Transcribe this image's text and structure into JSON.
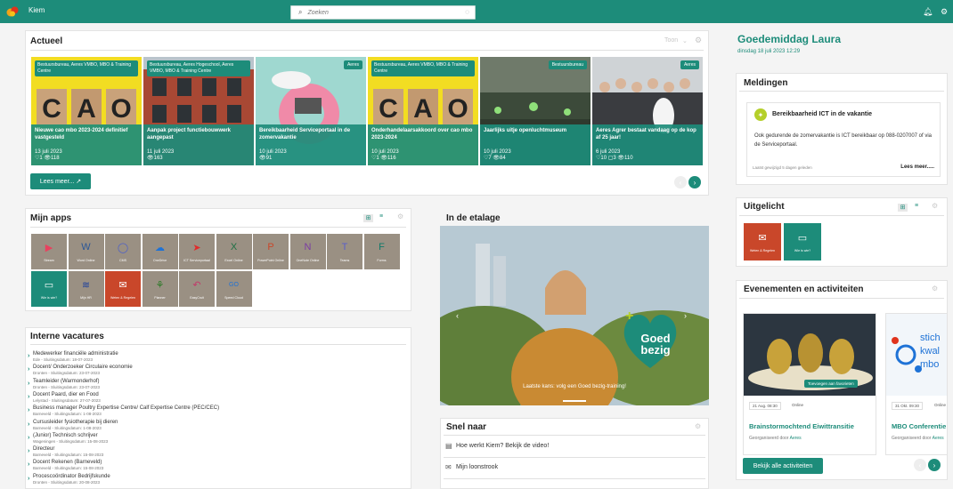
{
  "app": {
    "title": "Kiem"
  },
  "search": {
    "placeholder": "Zoeken"
  },
  "actueel": {
    "title": "Actueel",
    "toggle": "Toon",
    "tiles": [
      {
        "tag": "Bestuursbureau, Aeres VMBO, MBO & Training Centre",
        "title": "Nieuwe cao mbo 2023-2024 definitief vastgesteld",
        "date": "13 juli 2023",
        "meta": "♡1 👁118"
      },
      {
        "tag": "Bestuursbureau, Aeres Hogeschool, Aeres VMBO, MBO & Training Centre",
        "title": "Aanpak project functiebouwwerk aangepast",
        "date": "11 juli 2023",
        "meta": "👁163"
      },
      {
        "tag": "Aeres",
        "title": "Bereikbaarheid Serviceportaal in de zomervakantie",
        "date": "10 juli 2023",
        "meta": "👁91"
      },
      {
        "tag": "Bestuursbureau, Aeres VMBO, MBO & Training Centre",
        "title": "Onderhandelaarsakkoord over cao mbo 2023-2024",
        "date": "10 juli 2023",
        "meta": "♡1 👁116"
      },
      {
        "tag": "Bestuursbureau",
        "title": "Jaarlijks uitje openluchtmuseum",
        "date": "10 juli 2023",
        "meta": "♡7 👁84"
      },
      {
        "tag": "Aeres",
        "title": "Aeres Agrer bestaat vandaag op de kop af 25 jaar!",
        "date": "6 juli 2023",
        "meta": "♡10 ▢3 👁110"
      }
    ],
    "more_label": "Lees meer... ↗"
  },
  "greeting": {
    "title": "Goedemiddag Laura",
    "date": "dinsdag 18 juli 2023 12:29"
  },
  "meldingen": {
    "title": "Meldingen",
    "item_title": "Bereikbaarheid ICT in de vakantie",
    "item_body": "Ook gedurende de zomervakantie is ICT bereikbaar op 088-0207007 of via de Serviceportaal.",
    "item_time": "Laatst gewijzigd 5 dagen geleden",
    "item_more": "Lees meer....."
  },
  "apps": {
    "title": "Mijn apps",
    "items": [
      {
        "label": "Stream",
        "icon": "▶",
        "bg": "#9a9083",
        "ic": "#e8425f"
      },
      {
        "label": "Word Online",
        "icon": "W",
        "bg": "#9a9083",
        "ic": "#2b5797"
      },
      {
        "label": "CMS",
        "icon": "◯",
        "bg": "#9a9083",
        "ic": "#4b5fc9"
      },
      {
        "label": "OneDrive",
        "icon": "☁",
        "bg": "#9a9083",
        "ic": "#1e72d6"
      },
      {
        "label": "ICT Serviceportaal",
        "icon": "➤",
        "bg": "#9a9083",
        "ic": "#e02b2b"
      },
      {
        "label": "Excel Online",
        "icon": "X",
        "bg": "#9a9083",
        "ic": "#1d7044"
      },
      {
        "label": "PowerPoint Online",
        "icon": "P",
        "bg": "#9a9083",
        "ic": "#c9472a"
      },
      {
        "label": "OneNote Online",
        "icon": "N",
        "bg": "#9a9083",
        "ic": "#7b3da3"
      },
      {
        "label": "Teams",
        "icon": "T",
        "bg": "#9a9083",
        "ic": "#5a5fc9"
      },
      {
        "label": "Forms",
        "icon": "F",
        "bg": "#9a9083",
        "ic": "#0f7a6a"
      },
      {
        "label": "Wie is wie?",
        "icon": "▭",
        "bg": "#1d8c7a",
        "ic": "#ffffff"
      },
      {
        "label": "Mijn HR",
        "icon": "≋",
        "bg": "#9a9083",
        "ic": "#1c3f9c"
      },
      {
        "label": "Weten & Regelen",
        "icon": "✉",
        "bg": "#c9472a",
        "ic": "#ffffff"
      },
      {
        "label": "Planner",
        "icon": "⚘",
        "bg": "#9a9083",
        "ic": "#2f7a2a"
      },
      {
        "label": "EasyCruit",
        "icon": "↶",
        "bg": "#9a9083",
        "ic": "#c23a6a"
      },
      {
        "label": "Speed Cloud",
        "icon": "GO",
        "bg": "#9a9083",
        "ic": "#1e72d6"
      }
    ]
  },
  "etalage": {
    "title": "In de etalage",
    "caption": "Laatste kans: volg een Goed bezig-training!",
    "badge": "Goed bezig"
  },
  "uitgelicht": {
    "title": "Uitgelicht",
    "items": [
      {
        "label": "Weten & Regelen",
        "icon": "✉",
        "bg": "#c9472a"
      },
      {
        "label": "Wie is wie?",
        "icon": "▭",
        "bg": "#1d8c7a"
      }
    ]
  },
  "vacatures": {
    "title": "Interne vacatures",
    "items": [
      {
        "title": "Medewerker financiële administratie",
        "sub": "Ede - Sluitingsdatum: 18-07-2023"
      },
      {
        "title": "Docent/ Onderzoeker Circulaire economie",
        "sub": "Dronten - Sluitingsdatum: 23-07-2023"
      },
      {
        "title": "Teamleider (Warmonderhof)",
        "sub": "Dronten - Sluitingsdatum: 23-07-2023"
      },
      {
        "title": "Docent Paard, dier en Food",
        "sub": "Lelystad - Sluitingsdatum: 27-07-2023"
      },
      {
        "title": "Business manager Poultry Expertise Centre/ Calf Expertise Centre (PEC/CEC)",
        "sub": "Barneveld - Sluitingsdatum: 1-08-2023"
      },
      {
        "title": "Cursusleider fysiotherapie bij dieren",
        "sub": "Barneveld - Sluitingsdatum: 1-08-2023"
      },
      {
        "title": "(Junior) Technisch schrijver",
        "sub": "Wageningen - Sluitingsdatum: 15-08-2023"
      },
      {
        "title": "Directeur",
        "sub": "Barneveld - Sluitingsdatum: 15-08-2023"
      },
      {
        "title": "Docent Rekenen (Barneveld)",
        "sub": "Barneveld - Sluitingsdatum: 15-08-2023"
      },
      {
        "title": "Procescoördinator Bedrijfskunde",
        "sub": "Dronten - Sluitingsdatum: 20-08-2023"
      }
    ]
  },
  "snel": {
    "title": "Snel naar",
    "items": [
      {
        "label": "Hoe werkt Kiem? Bekijk de video!",
        "icon": "▤"
      },
      {
        "label": "Mijn loonstrook",
        "icon": "✉"
      }
    ]
  },
  "events": {
    "title": "Evenementen en activiteiten",
    "items": [
      {
        "month": "21 Aug. 08:30",
        "loc": "Online",
        "title": "Brainstormochtend Eiwittransitie",
        "org_prefix": "Georganiseerd door",
        "org": "Aeres",
        "badge": "Toevoegen aan favorieten"
      },
      {
        "month": "31 Okt. 09:30",
        "loc": "Online",
        "title": "MBO Conferentie",
        "org_prefix": "Georganiseerd door",
        "org": "Aeres",
        "badge": ""
      }
    ],
    "all_label": "Bekijk alle activiteiten"
  },
  "colors": {
    "accent": "#1d8c7a",
    "notif_icon": "#b4cf2a",
    "link": "#1d8c7a"
  }
}
